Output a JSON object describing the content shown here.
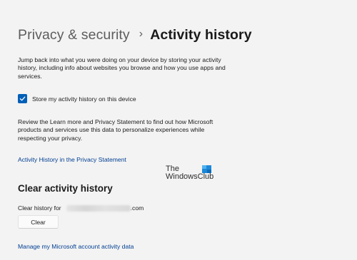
{
  "breadcrumb": {
    "parent": "Privacy & security",
    "separator": "›",
    "current": "Activity history"
  },
  "description": "Jump back into what you were doing on your device by storing your activity history, including info about websites you browse and how you use apps and services.",
  "store_activity": {
    "label": "Store my activity history on this device",
    "checked": true
  },
  "review_text": "Review the Learn more and Privacy Statement to find out how Microsoft products and services use this data to personalize experiences while respecting your privacy.",
  "privacy_link": "Activity History in the Privacy Statement",
  "watermark": {
    "line1": "The",
    "line2": "WindowsClub"
  },
  "clear_section": {
    "title": "Clear activity history",
    "clear_for_label": "Clear history for",
    "account_suffix": ".com",
    "button_label": "Clear"
  },
  "manage_link": "Manage my Microsoft account activity data",
  "colors": {
    "accent": "#005fb8",
    "link": "#003e92",
    "background": "#f3f3f3"
  }
}
